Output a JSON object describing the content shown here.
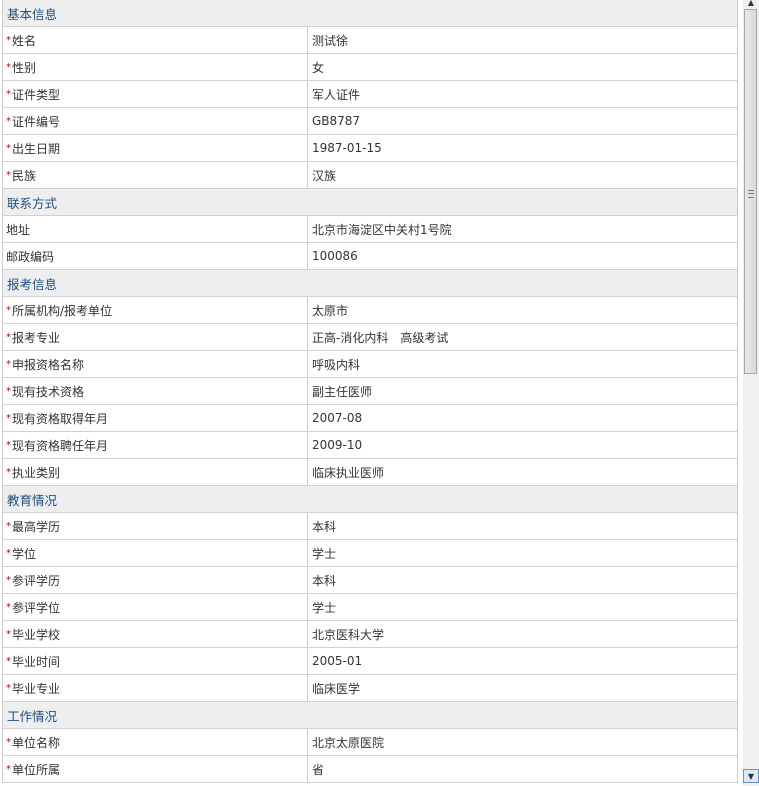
{
  "sections": [
    {
      "title": "基本信息",
      "rows": [
        {
          "label": "姓名",
          "value": "测试徐",
          "required": true
        },
        {
          "label": "性别",
          "value": "女",
          "required": true
        },
        {
          "label": "证件类型",
          "value": "军人证件",
          "required": true
        },
        {
          "label": "证件编号",
          "value": "GB8787",
          "required": true
        },
        {
          "label": "出生日期",
          "value": "1987-01-15",
          "required": true
        },
        {
          "label": "民族",
          "value": "汉族",
          "required": true
        }
      ]
    },
    {
      "title": "联系方式",
      "rows": [
        {
          "label": "地址",
          "value": "北京市海淀区中关村1号院",
          "required": false
        },
        {
          "label": "邮政编码",
          "value": "100086",
          "required": false
        }
      ]
    },
    {
      "title": "报考信息",
      "rows": [
        {
          "label": "所属机构/报考单位",
          "value": "太原市",
          "required": true
        },
        {
          "label": "报考专业",
          "value": "正高-消化内科　高级考试",
          "required": true
        },
        {
          "label": "申报资格名称",
          "value": "呼吸内科",
          "required": true
        },
        {
          "label": "现有技术资格",
          "value": "副主任医师",
          "required": true
        },
        {
          "label": "现有资格取得年月",
          "value": "2007-08",
          "required": true
        },
        {
          "label": "现有资格聘任年月",
          "value": "2009-10",
          "required": true
        },
        {
          "label": "执业类别",
          "value": "临床执业医师",
          "required": true
        }
      ]
    },
    {
      "title": "教育情况",
      "rows": [
        {
          "label": "最高学历",
          "value": "本科",
          "required": true
        },
        {
          "label": "学位",
          "value": "学士",
          "required": true
        },
        {
          "label": "参评学历",
          "value": "本科",
          "required": true
        },
        {
          "label": "参评学位",
          "value": "学士",
          "required": true
        },
        {
          "label": "毕业学校",
          "value": "北京医科大学",
          "required": true
        },
        {
          "label": "毕业时间",
          "value": "2005-01",
          "required": true
        },
        {
          "label": "毕业专业",
          "value": "临床医学",
          "required": true
        }
      ]
    },
    {
      "title": "工作情况",
      "rows": [
        {
          "label": "单位名称",
          "value": "北京太原医院",
          "required": true
        },
        {
          "label": "单位所属",
          "value": "省",
          "required": true
        }
      ]
    }
  ],
  "required_mark": "*",
  "scrollbar": {
    "up": "▲",
    "down": "▼"
  }
}
